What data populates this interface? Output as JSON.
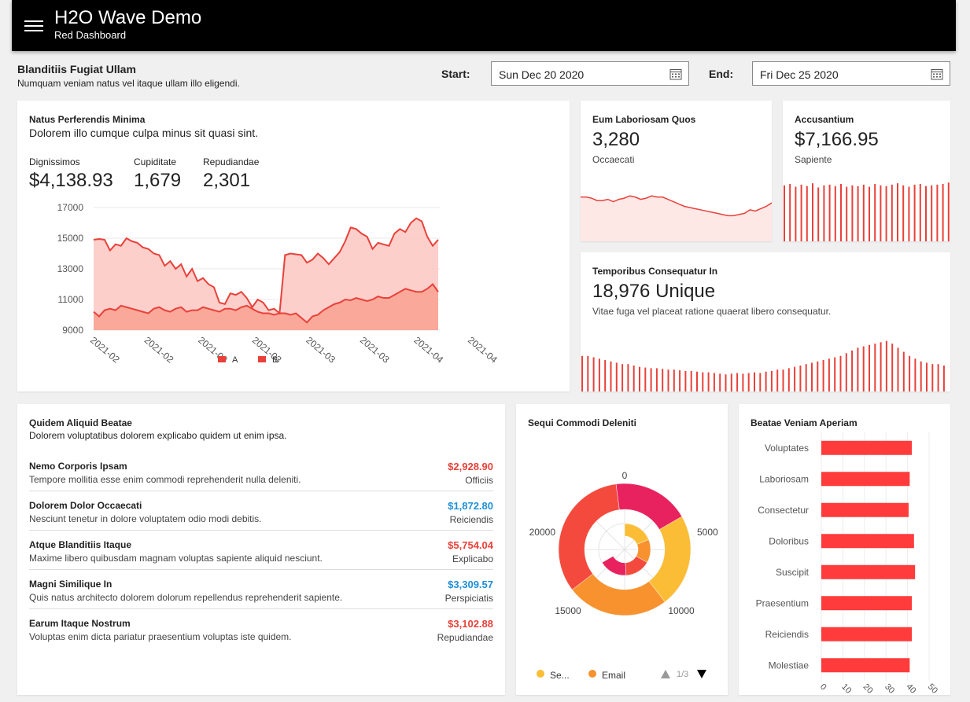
{
  "header": {
    "title": "H2O Wave Demo",
    "subtitle": "Red Dashboard"
  },
  "section": {
    "title": "Blanditiis Fugiat Ullam",
    "subtitle": "Numquam veniam natus vel itaque ullam illo eligendi.",
    "start_label": "Start:",
    "start_value": "Sun Dec 20 2020",
    "end_label": "End:",
    "end_value": "Fri Dec 25 2020"
  },
  "main_card": {
    "title": "Natus Perferendis Minima",
    "subtitle": "Dolorem illo cumque culpa minus sit quasi sint.",
    "stats": [
      {
        "label": "Dignissimos",
        "value": "$4,138.93"
      },
      {
        "label": "Cupiditate",
        "value": "1,679"
      },
      {
        "label": "Repudiandae",
        "value": "2,301"
      }
    ]
  },
  "stat_card_1": {
    "title": "Eum Laboriosam Quos",
    "value": "3,280",
    "caption": "Occaecati"
  },
  "stat_card_2": {
    "title": "Accusantium",
    "value": "$7,166.95",
    "caption": "Sapiente"
  },
  "stat_card_3": {
    "title": "Temporibus Consequatur In",
    "value": "18,976 Unique",
    "caption": "Vitae fuga vel placeat ratione quaerat libero consequatur."
  },
  "list_card": {
    "title": "Quidem Aliquid Beatae",
    "subtitle": "Dolorem voluptatibus dolorem explicabo quidem ut enim ipsa.",
    "items": [
      {
        "title": "Nemo Corporis Ipsam",
        "desc": "Tempore mollitia esse enim commodi reprehenderit nulla deleniti.",
        "value": "$2,928.90",
        "caption": "Officiis",
        "color": "#e8413a"
      },
      {
        "title": "Dolorem Dolor Occaecati",
        "desc": "Nesciunt tenetur in dolore voluptatem odio modi debitis.",
        "value": "$1,872.80",
        "caption": "Reiciendis",
        "color": "#1e8fd6"
      },
      {
        "title": "Atque Blanditiis Itaque",
        "desc": "Maxime libero quibusdam magnam voluptas sapiente aliquid nesciunt.",
        "value": "$5,754.04",
        "caption": "Explicabo",
        "color": "#e8413a"
      },
      {
        "title": "Magni Similique In",
        "desc": "Quis natus architecto dolorem dolorum repellendus reprehenderit sapiente.",
        "value": "$3,309.57",
        "caption": "Perspiciatis",
        "color": "#1e8fd6"
      },
      {
        "title": "Earum Itaque Nostrum",
        "desc": "Voluptas enim dicta pariatur praesentium voluptas iste quidem.",
        "value": "$3,102.88",
        "caption": "Repudiandae",
        "color": "#e8413a"
      }
    ]
  },
  "donut_card": {
    "title": "Sequi Commodi Deleniti",
    "legend": [
      "Se...",
      "Email"
    ],
    "page": "1/3"
  },
  "bar_card": {
    "title": "Beatae Veniam Aperiam"
  },
  "colors": {
    "accent": "#e8413a",
    "area_a": "#fdc7c2",
    "area_b": "#f9a393",
    "bar": "#ff3b3b"
  },
  "chart_data": [
    {
      "type": "area",
      "x_ticks": [
        "2021-02",
        "2021-02",
        "2021-03",
        "2021-03",
        "2021-03",
        "2021-03",
        "2021-04",
        "2021-04"
      ],
      "ylim": [
        9000,
        17000
      ],
      "y_ticks": [
        9000,
        11000,
        13000,
        15000,
        17000
      ],
      "series": [
        {
          "name": "A",
          "values": [
            14900,
            14950,
            14900,
            14200,
            14600,
            14500,
            15000,
            14800,
            14700,
            14400,
            14300,
            14000,
            13900,
            13200,
            13500,
            13000,
            13300,
            12500,
            13000,
            12200,
            12400,
            12000,
            11800,
            10800,
            10700,
            11400,
            11300,
            11500,
            11100,
            10500,
            11000,
            10800,
            10300,
            10400,
            10100,
            13900,
            14000,
            13950,
            13900,
            13400,
            13600,
            14000,
            13700,
            13300,
            13700,
            14100,
            14800,
            15700,
            15600,
            15300,
            15100,
            14300,
            14700,
            14600,
            14500,
            15300,
            15600,
            15400,
            16000,
            16300,
            16100,
            15100,
            14500,
            14900
          ]
        },
        {
          "name": "B",
          "values": [
            10200,
            9900,
            10300,
            10400,
            10300,
            10600,
            10500,
            10400,
            10300,
            10200,
            10100,
            10400,
            10500,
            10300,
            10200,
            10400,
            10500,
            10200,
            10300,
            10300,
            10500,
            10400,
            10300,
            10200,
            10400,
            10400,
            10300,
            10500,
            10600,
            10400,
            10200,
            10100,
            10100,
            10000,
            10100,
            10100,
            10000,
            10100,
            9800,
            9500,
            9900,
            10000,
            10300,
            10500,
            10700,
            10800,
            11000,
            10950,
            11100,
            11000,
            10900,
            11000,
            11200,
            11100,
            11100,
            11300,
            11500,
            11700,
            11600,
            11500,
            11500,
            11700,
            12000,
            11500
          ]
        }
      ]
    },
    {
      "type": "area",
      "values": [
        78,
        78,
        77,
        75,
        75,
        76,
        74,
        76,
        77,
        79,
        78,
        76,
        77,
        79,
        78,
        78,
        76,
        74,
        72,
        70,
        69,
        68,
        67,
        66,
        65,
        64,
        63,
        62,
        62,
        63,
        64,
        67,
        66,
        68,
        70,
        73
      ]
    },
    {
      "type": "bar",
      "values": [
        80,
        82,
        78,
        81,
        79,
        83,
        77,
        80,
        81,
        79,
        82,
        78,
        80,
        79,
        81,
        78,
        82,
        80,
        79,
        81,
        83,
        80,
        78,
        81,
        82,
        79,
        80,
        81,
        82,
        84
      ]
    },
    {
      "type": "bar",
      "values": [
        52,
        52,
        50,
        48,
        46,
        44,
        42,
        40,
        40,
        38,
        36,
        35,
        34,
        34,
        33,
        32,
        32,
        31,
        30,
        30,
        29,
        28,
        28,
        27,
        26,
        25,
        26,
        27,
        26,
        27,
        28,
        27,
        29,
        30,
        32,
        32,
        34,
        36,
        38,
        40,
        42,
        44,
        46,
        48,
        50,
        52,
        56,
        60,
        64,
        66,
        68,
        70,
        72,
        74,
        70,
        64,
        58,
        52,
        48,
        44,
        42,
        40,
        40,
        38
      ]
    },
    {
      "type": "pie",
      "axis_ticks": [
        "0",
        "5000",
        "10000",
        "15000",
        "20000"
      ],
      "rings": [
        {
          "values": [
            9500,
            6000,
            8000,
            4500
          ],
          "colors": [
            "#fbbd35",
            "#f7922e",
            "#f44a3e",
            "#e8225f"
          ]
        },
        {
          "values": [
            4500,
            3500,
            3800,
            4200
          ],
          "colors": [
            "#fbbd35",
            "#f7922e",
            "#f44a3e",
            "#e8225f"
          ]
        }
      ],
      "max": 24000
    },
    {
      "type": "bar",
      "orientation": "horizontal",
      "categories": [
        "Voluptates",
        "Laboriosam",
        "Consectetur",
        "Doloribus",
        "Suscipit",
        "Praesentium",
        "Reiciendis",
        "Molestiae"
      ],
      "values": [
        42,
        41,
        40.5,
        43,
        43.5,
        42,
        42,
        41
      ],
      "x_ticks": [
        "0",
        "10",
        "20",
        "30",
        "40",
        "50"
      ],
      "xlim": [
        0,
        50
      ]
    }
  ]
}
